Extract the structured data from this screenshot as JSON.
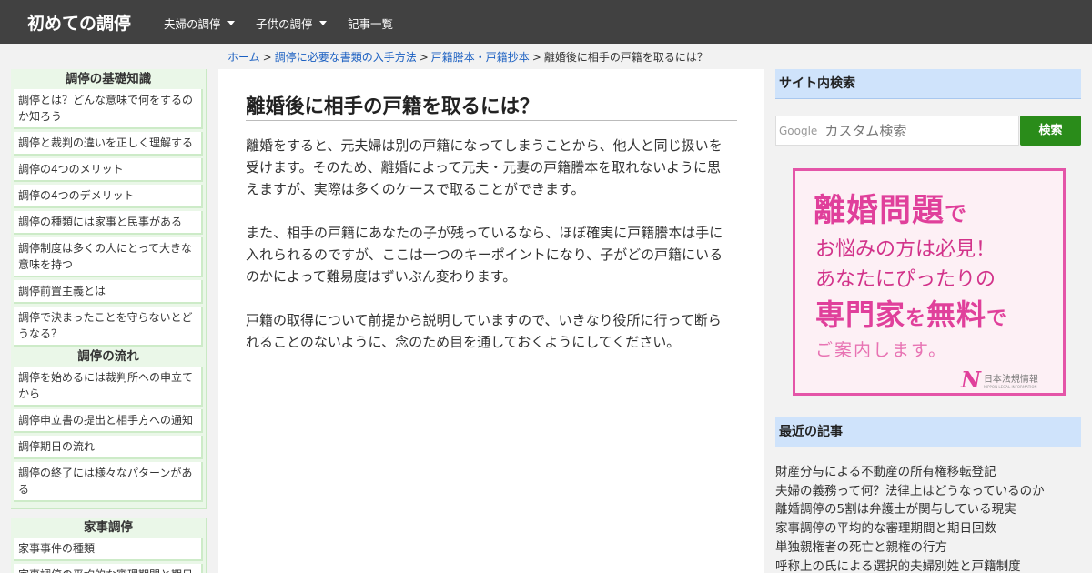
{
  "header": {
    "brand": "初めての調停",
    "nav": [
      {
        "label": "夫婦の調停",
        "dropdown": true
      },
      {
        "label": "子供の調停",
        "dropdown": true
      },
      {
        "label": "記事一覧",
        "dropdown": false
      }
    ]
  },
  "breadcrumb": {
    "items": [
      "ホーム",
      "調停に必要な書類の入手方法",
      "戸籍謄本・戸籍抄本"
    ],
    "current": "離婚後に相手の戸籍を取るには？",
    "separator": ">"
  },
  "sidebar": {
    "sections": [
      {
        "title": "調停の基礎知識",
        "items": [
          "調停とは？どんな意味で何をするのか知ろう",
          "調停と裁判の違いを正しく理解する",
          "調停の4つのメリット",
          "調停の4つのデメリット",
          "調停の種類には家事と民事がある",
          "調停制度は多くの人にとって大きな意味を持つ",
          "調停前置主義とは",
          "調停で決まったことを守らないとどうなる？"
        ]
      },
      {
        "title": "調停の流れ",
        "items": [
          "調停を始めるには裁判所への申立てから",
          "調停申立書の提出と相手方への通知",
          "調停期日の流れ",
          "調停の終了には様々なパターンがある"
        ]
      },
      {
        "title": "家事調停",
        "items": [
          "家事事件の種類",
          "家事調停の平均的な審理期間と期日"
        ]
      }
    ]
  },
  "article": {
    "title": "離婚後に相手の戸籍を取るには？",
    "paragraphs": [
      "離婚をすると、元夫婦は別の戸籍になってしまうことから、他人と同じ扱いを受けます。そのため、離婚によって元夫・元妻の戸籍謄本を取れないように思えますが、実際は多くのケースで取ることができます。",
      "また、相手の戸籍にあなたの子が残っているなら、ほぼ確実に戸籍謄本は手に入れられるのですが、ここは一つのキーポイントになり、子がどの戸籍にいるのかによって難易度はずいぶん変わります。",
      "戸籍の取得について前提から説明していますので、いきなり役所に行って断られることのないように、念のため目を通しておくようにしてください。"
    ]
  },
  "right": {
    "search_title": "サイト内検索",
    "search_brand": "Google",
    "search_placeholder": "カスタム検索",
    "search_button": "検索",
    "ad": {
      "line1_big": "離婚問題",
      "line1_small": "で",
      "line2": "お悩みの方は必見！",
      "line3": "あなたにぴったりの",
      "line4_a": "専門家",
      "line4_b": "を",
      "line4_c": "無料",
      "line4_d": "で",
      "line5": "ご案内します。",
      "logo_name": "日本法規情報",
      "logo_sub": "NIPPON LEGAL INFORMATION"
    },
    "recent_title": "最近の記事",
    "recent": [
      "財産分与による不動産の所有権移転登記",
      "夫婦の義務って何？法律上はどうなっているのか",
      "離婚調停の5割は弁護士が関与している現実",
      "家事調停の平均的な審理期間と期日回数",
      "単独親権者の死亡と親権の行方",
      "呼称上の氏による選択的夫婦別姓と戸籍制度"
    ]
  },
  "colors": {
    "topbar": "#414141",
    "sidebar_bg": "#eaf7e8",
    "right_header_bg": "#cfe3fb",
    "search_button": "#2a8c1a",
    "ad_accent": "#e0409b",
    "link": "#1a5fc1"
  }
}
